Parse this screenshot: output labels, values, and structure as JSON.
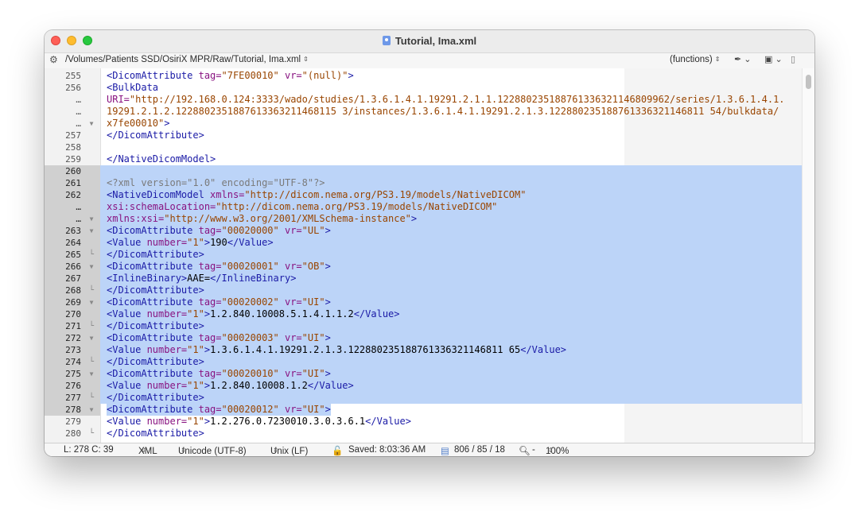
{
  "window": {
    "title": "Tutorial, Ima.xml"
  },
  "navbar": {
    "gear_icon": "gear-icon",
    "path": "/Volumes/Patients SSD/OsiriX MPR/Raw/Tutorial, Ima.xml",
    "functions": "(functions)"
  },
  "editor": {
    "lines": [
      {
        "num": "255",
        "fold": "",
        "selected": false,
        "tokens": [
          [
            "tag",
            "<DicomAttribute "
          ],
          [
            "attr",
            "tag="
          ],
          [
            "str",
            "\"7FE00010\""
          ],
          [
            "attr",
            " vr="
          ],
          [
            "str",
            "\"(null)\""
          ],
          [
            "tag",
            ">"
          ]
        ]
      },
      {
        "num": "256",
        "fold": "",
        "selected": false,
        "tokens": [
          [
            "tag",
            "<BulkData"
          ]
        ]
      },
      {
        "num": "…",
        "fold": "",
        "selected": false,
        "tokens": [
          [
            "attr",
            "URI="
          ],
          [
            "str",
            "\"http://192.168.0.124:3333/wado/studies/1.3.6.1.4.1.19291.2.1.1.122880235188761336321146809962/series/1.3.6.1.4.1."
          ]
        ]
      },
      {
        "num": "…",
        "fold": "",
        "selected": false,
        "tokens": [
          [
            "str",
            "19291.2.1.2.1228802351887613363211468115 3/instances/1.3.6.1.4.1.19291.2.1.3.122880235188761336321146811 54/bulkdata/"
          ]
        ]
      },
      {
        "num": "…",
        "fold": "down",
        "selected": false,
        "tokens": [
          [
            "str",
            "x7fe00010\""
          ],
          [
            "tag",
            ">"
          ]
        ]
      },
      {
        "num": "257",
        "fold": "",
        "selected": false,
        "tokens": [
          [
            "tag",
            "</DicomAttribute>"
          ]
        ]
      },
      {
        "num": "258",
        "fold": "",
        "selected": false,
        "tokens": []
      },
      {
        "num": "259",
        "fold": "",
        "selected": false,
        "tokens": [
          [
            "tag",
            "</NativeDicomModel>"
          ]
        ]
      },
      {
        "num": "260",
        "fold": "",
        "selected": true,
        "tokens": []
      },
      {
        "num": "261",
        "fold": "",
        "selected": true,
        "tokens": [
          [
            "pi",
            "<?xml version=\"1.0\" encoding=\"UTF-8\"?>"
          ]
        ]
      },
      {
        "num": "262",
        "fold": "",
        "selected": true,
        "tokens": [
          [
            "tag",
            "<NativeDicomModel "
          ],
          [
            "attr",
            "xmlns="
          ],
          [
            "str",
            "\"http://dicom.nema.org/PS3.19/models/NativeDICOM\""
          ]
        ]
      },
      {
        "num": "…",
        "fold": "",
        "selected": true,
        "tokens": [
          [
            "attr",
            "xsi:schemaLocation="
          ],
          [
            "str",
            "\"http://dicom.nema.org/PS3.19/models/NativeDICOM\""
          ]
        ]
      },
      {
        "num": "…",
        "fold": "down",
        "selected": true,
        "tokens": [
          [
            "attr",
            "xmlns:xsi="
          ],
          [
            "str",
            "\"http://www.w3.org/2001/XMLSchema-instance\""
          ],
          [
            "tag",
            ">"
          ]
        ]
      },
      {
        "num": "263",
        "fold": "down",
        "selected": true,
        "tokens": [
          [
            "tag",
            "<DicomAttribute "
          ],
          [
            "attr",
            "tag="
          ],
          [
            "str",
            "\"00020000\""
          ],
          [
            "attr",
            " vr="
          ],
          [
            "str",
            "\"UL\""
          ],
          [
            "tag",
            ">"
          ]
        ]
      },
      {
        "num": "264",
        "fold": "",
        "selected": true,
        "tokens": [
          [
            "tag",
            "<Value "
          ],
          [
            "attr",
            "number="
          ],
          [
            "str",
            "\"1\""
          ],
          [
            "tag",
            ">"
          ],
          [
            "txt",
            "190"
          ],
          [
            "tag",
            "</Value>"
          ]
        ]
      },
      {
        "num": "265",
        "fold": "end",
        "selected": true,
        "tokens": [
          [
            "tag",
            "</DicomAttribute>"
          ]
        ]
      },
      {
        "num": "266",
        "fold": "down",
        "selected": true,
        "tokens": [
          [
            "tag",
            "<DicomAttribute "
          ],
          [
            "attr",
            "tag="
          ],
          [
            "str",
            "\"00020001\""
          ],
          [
            "attr",
            " vr="
          ],
          [
            "str",
            "\"OB\""
          ],
          [
            "tag",
            ">"
          ]
        ]
      },
      {
        "num": "267",
        "fold": "",
        "selected": true,
        "tokens": [
          [
            "tag",
            "<InlineBinary>"
          ],
          [
            "txt",
            "AAE="
          ],
          [
            "tag",
            "</InlineBinary>"
          ]
        ]
      },
      {
        "num": "268",
        "fold": "end",
        "selected": true,
        "tokens": [
          [
            "tag",
            "</DicomAttribute>"
          ]
        ]
      },
      {
        "num": "269",
        "fold": "down",
        "selected": true,
        "tokens": [
          [
            "tag",
            "<DicomAttribute "
          ],
          [
            "attr",
            "tag="
          ],
          [
            "str",
            "\"00020002\""
          ],
          [
            "attr",
            " vr="
          ],
          [
            "str",
            "\"UI\""
          ],
          [
            "tag",
            ">"
          ]
        ]
      },
      {
        "num": "270",
        "fold": "",
        "selected": true,
        "tokens": [
          [
            "tag",
            "<Value "
          ],
          [
            "attr",
            "number="
          ],
          [
            "str",
            "\"1\""
          ],
          [
            "tag",
            ">"
          ],
          [
            "txt",
            "1.2.840.10008.5.1.4.1.1.2"
          ],
          [
            "tag",
            "</Value>"
          ]
        ]
      },
      {
        "num": "271",
        "fold": "end",
        "selected": true,
        "tokens": [
          [
            "tag",
            "</DicomAttribute>"
          ]
        ]
      },
      {
        "num": "272",
        "fold": "down",
        "selected": true,
        "tokens": [
          [
            "tag",
            "<DicomAttribute "
          ],
          [
            "attr",
            "tag="
          ],
          [
            "str",
            "\"00020003\""
          ],
          [
            "attr",
            " vr="
          ],
          [
            "str",
            "\"UI\""
          ],
          [
            "tag",
            ">"
          ]
        ]
      },
      {
        "num": "273",
        "fold": "",
        "selected": true,
        "tokens": [
          [
            "tag",
            "<Value "
          ],
          [
            "attr",
            "number="
          ],
          [
            "str",
            "\"1\""
          ],
          [
            "tag",
            ">"
          ],
          [
            "txt",
            "1.3.6.1.4.1.19291.2.1.3.122880235188761336321146811 65"
          ],
          [
            "tag",
            "</Value>"
          ]
        ]
      },
      {
        "num": "274",
        "fold": "end",
        "selected": true,
        "tokens": [
          [
            "tag",
            "</DicomAttribute>"
          ]
        ]
      },
      {
        "num": "275",
        "fold": "down",
        "selected": true,
        "tokens": [
          [
            "tag",
            "<DicomAttribute "
          ],
          [
            "attr",
            "tag="
          ],
          [
            "str",
            "\"00020010\""
          ],
          [
            "attr",
            " vr="
          ],
          [
            "str",
            "\"UI\""
          ],
          [
            "tag",
            ">"
          ]
        ]
      },
      {
        "num": "276",
        "fold": "",
        "selected": true,
        "tokens": [
          [
            "tag",
            "<Value "
          ],
          [
            "attr",
            "number="
          ],
          [
            "str",
            "\"1\""
          ],
          [
            "tag",
            ">"
          ],
          [
            "txt",
            "1.2.840.10008.1.2"
          ],
          [
            "tag",
            "</Value>"
          ]
        ]
      },
      {
        "num": "277",
        "fold": "end",
        "selected": true,
        "tokens": [
          [
            "tag",
            "</DicomAttribute>"
          ]
        ]
      },
      {
        "num": "278",
        "fold": "down",
        "selected": "partial",
        "tokens": [
          [
            "tag",
            "<DicomAttribute "
          ],
          [
            "attr",
            "tag="
          ],
          [
            "str",
            "\"00020012\""
          ],
          [
            "attr",
            " vr="
          ],
          [
            "str",
            "\"UI\""
          ],
          [
            "tag",
            ">"
          ]
        ]
      },
      {
        "num": "279",
        "fold": "",
        "selected": false,
        "tokens": [
          [
            "tag",
            "<Value "
          ],
          [
            "attr",
            "number="
          ],
          [
            "str",
            "\"1\""
          ],
          [
            "tag",
            ">"
          ],
          [
            "txt",
            "1.2.276.0.7230010.3.0.3.6.1"
          ],
          [
            "tag",
            "</Value>"
          ]
        ]
      },
      {
        "num": "280",
        "fold": "end",
        "selected": false,
        "tokens": [
          [
            "tag",
            "</DicomAttribute>"
          ]
        ]
      }
    ]
  },
  "status": {
    "position": "L: 278 C: 39",
    "syntax": "XML",
    "encoding": "Unicode (UTF-8)",
    "line_endings": "Unix (LF)",
    "saved": "Saved: 8:03:36 AM",
    "counts": "806 / 85 / 18",
    "zoom_minus": "-",
    "zoom": "100%"
  }
}
